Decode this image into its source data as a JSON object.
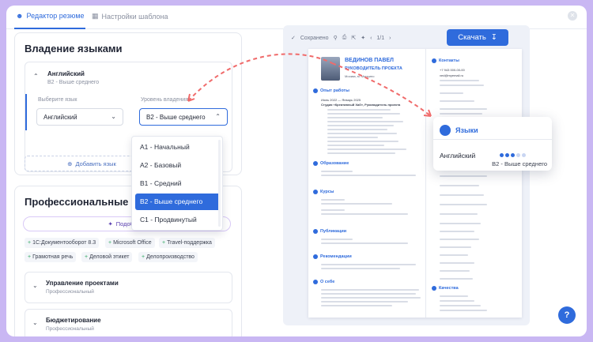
{
  "tabs": {
    "active": "Редактор резюме",
    "inactive": "Настройки шаблона"
  },
  "languages": {
    "title": "Владение языками",
    "item": {
      "name": "Английский",
      "level": "B2 - Выше среднего"
    },
    "choose_lang_label": "Выберите язык",
    "choose_lang_value": "Английский",
    "level_label": "Уровень владения",
    "level_value": "B2 - Выше среднего",
    "add_label": "Добавить язык",
    "dropdown": [
      {
        "label": "A1 - Начальный"
      },
      {
        "label": "A2 - Базовый"
      },
      {
        "label": "B1 - Средний"
      },
      {
        "label": "B2 - Выше среднего"
      },
      {
        "label": "C1 - Продвинутый"
      }
    ]
  },
  "skills": {
    "title": "Профессиональные нав",
    "ai_button": "Подобрать",
    "chips": [
      "1С:Документооборот 8.3",
      "Microsoft Office",
      "Travel-поддержка",
      "Грамотная речь",
      "Деловой этикет",
      "Делопроизводство"
    ],
    "sub_items": [
      {
        "title": "Управление проектами",
        "subtitle": "Профессиональный"
      },
      {
        "title": "Бюджетирование",
        "subtitle": "Профессиональный"
      }
    ]
  },
  "preview": {
    "saved": "Сохранено",
    "page": "1/1",
    "download": "Скачать",
    "name": "ВЕДИНОВ ПАВЕЛ",
    "role": "РУКОВОДИТЕЛЬ ПРОЕКТА",
    "location": "Москва, м. Марьино",
    "sections": [
      "Опыт работы",
      "Образование",
      "Курсы",
      "Публикации",
      "Рекомендации",
      "О себе",
      "Контакты",
      "Языки",
      "Качества"
    ],
    "experience_dates": "Июнь 2022 — Январь 2025",
    "experience_company": "Студия «Креативный Хаб», Руководитель проекта",
    "phone": "+7 943 000-00-00",
    "email": "ved@myemail.ru",
    "popup": {
      "title": "Языки",
      "lang": "Английский",
      "level": "B2 - Выше среднего",
      "filled": 3,
      "total": 5
    }
  },
  "colors": {
    "accent": "#2f6bdc",
    "dot_empty": "#c9d6f2"
  },
  "help": "?"
}
